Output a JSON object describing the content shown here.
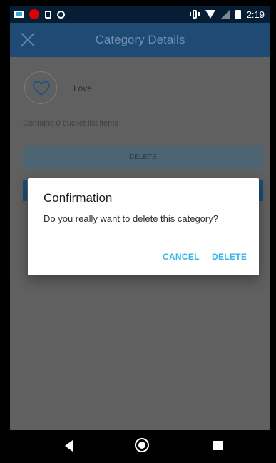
{
  "status_bar": {
    "time": "2:19",
    "icons": [
      "image-icon",
      "notification-dot-icon",
      "square-icon",
      "circle-icon",
      "vibrate-icon",
      "wifi-icon",
      "signal-icon",
      "battery-icon"
    ]
  },
  "app_bar": {
    "title": "Category Details",
    "close_icon": "close-icon"
  },
  "category": {
    "icon": "heart-icon",
    "name": "Love",
    "summary": "Contains 0 bucket list items",
    "delete_label": "DELETE"
  },
  "dialog": {
    "title": "Confirmation",
    "message": "Do you really want to delete this category?",
    "cancel_label": "CANCEL",
    "delete_label": "DELETE",
    "accent_color": "#33b5e5"
  },
  "nav_bar": {
    "icons": [
      "back-icon",
      "home-icon",
      "recents-icon"
    ]
  }
}
